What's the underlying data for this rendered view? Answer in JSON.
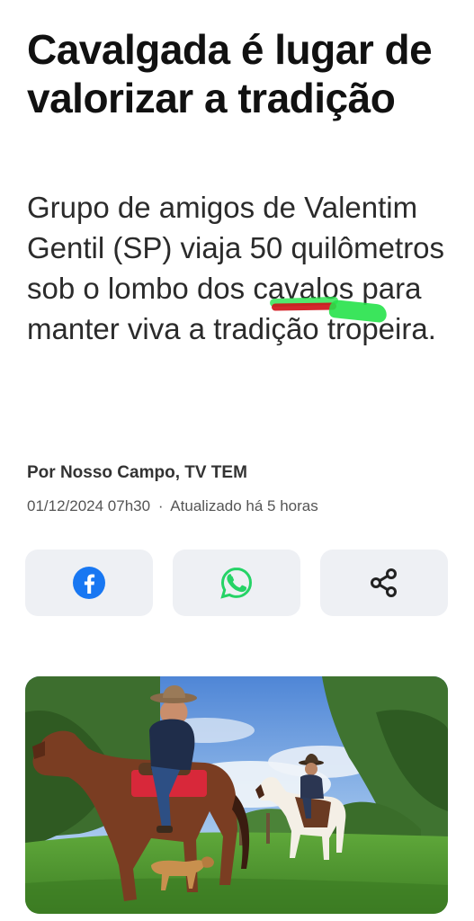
{
  "article": {
    "headline": "Cavalgada é lugar de valorizar a tradição",
    "subtitle": "Grupo de amigos de Valentim Gentil (SP) viaja 50 quilômetros sob o lombo dos cavalos para manter viva a tradição tropeira.",
    "byline": "Por Nosso Campo, TV TEM",
    "published": "01/12/2024 07h30",
    "separator": "·",
    "updated": "Atualizado há 5 horas"
  },
  "share": {
    "facebook_icon": "facebook-icon",
    "whatsapp_icon": "whatsapp-icon",
    "share_icon": "share-icon",
    "colors": {
      "facebook": "#1877f2",
      "whatsapp": "#25d366",
      "share": "#222222",
      "button_bg": "#eef0f4"
    }
  },
  "annotations": {
    "underline_red": "#d0141b",
    "underline_green": "#26e24a"
  }
}
